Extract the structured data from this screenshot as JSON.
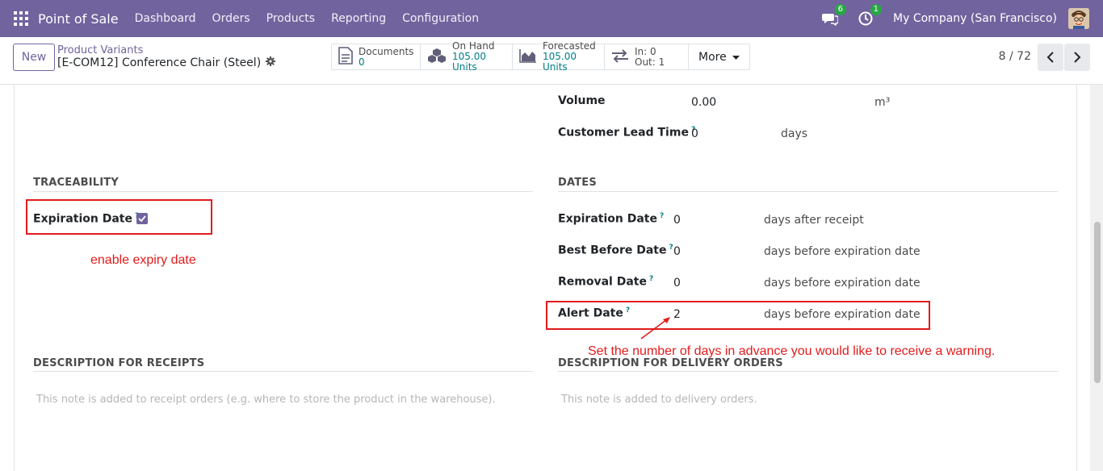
{
  "navbar": {
    "app_name": "Point of Sale",
    "menu": [
      "Dashboard",
      "Orders",
      "Products",
      "Reporting",
      "Configuration"
    ],
    "messages_count": "6",
    "activity_count": "1",
    "company": "My Company (San Francisco)",
    "bg_color": "#71639e"
  },
  "control": {
    "new_label": "New",
    "breadcrumb": "Product Variants",
    "record_title": "[E-COM12] Conference Chair (Steel)",
    "stats": {
      "documents_label": "Documents",
      "documents_value": "0",
      "onhand_label": "On Hand",
      "onhand_value": "105.00 Units",
      "forecasted_label": "Forecasted",
      "forecasted_value": "105.00 Units",
      "in_label": "In: 0",
      "out_label": "Out: 1",
      "more_label": "More"
    },
    "pager": "8 / 72"
  },
  "form": {
    "volume_label": "Volume",
    "volume_value": "0.00",
    "volume_unit": "m³",
    "lead_time_label": "Customer Lead Time",
    "lead_time_value": "0",
    "lead_time_unit": "days",
    "traceability_title": "TRACEABILITY",
    "expiration_checkbox_label": "Expiration Date",
    "dates_title": "DATES",
    "dates": [
      {
        "label": "Expiration Date",
        "value": "0",
        "unit": "days after receipt"
      },
      {
        "label": "Best Before Date",
        "value": "0",
        "unit": "days before expiration date"
      },
      {
        "label": "Removal Date",
        "value": "0",
        "unit": "days before expiration date"
      },
      {
        "label": "Alert Date",
        "value": "2",
        "unit": "days before expiration date"
      }
    ],
    "receipts_title": "DESCRIPTION FOR RECEIPTS",
    "receipts_placeholder": "This note is added to receipt orders (e.g. where to store the product in the warehouse).",
    "delivery_title": "DESCRIPTION FOR DELIVERY ORDERS",
    "delivery_placeholder": "This note is added to delivery orders."
  },
  "annotations": {
    "enable_expiry": "enable expiry date",
    "alert_hint": "Set the number of days in advance you would like to receive a warning.",
    "color": "#e31b1b"
  }
}
